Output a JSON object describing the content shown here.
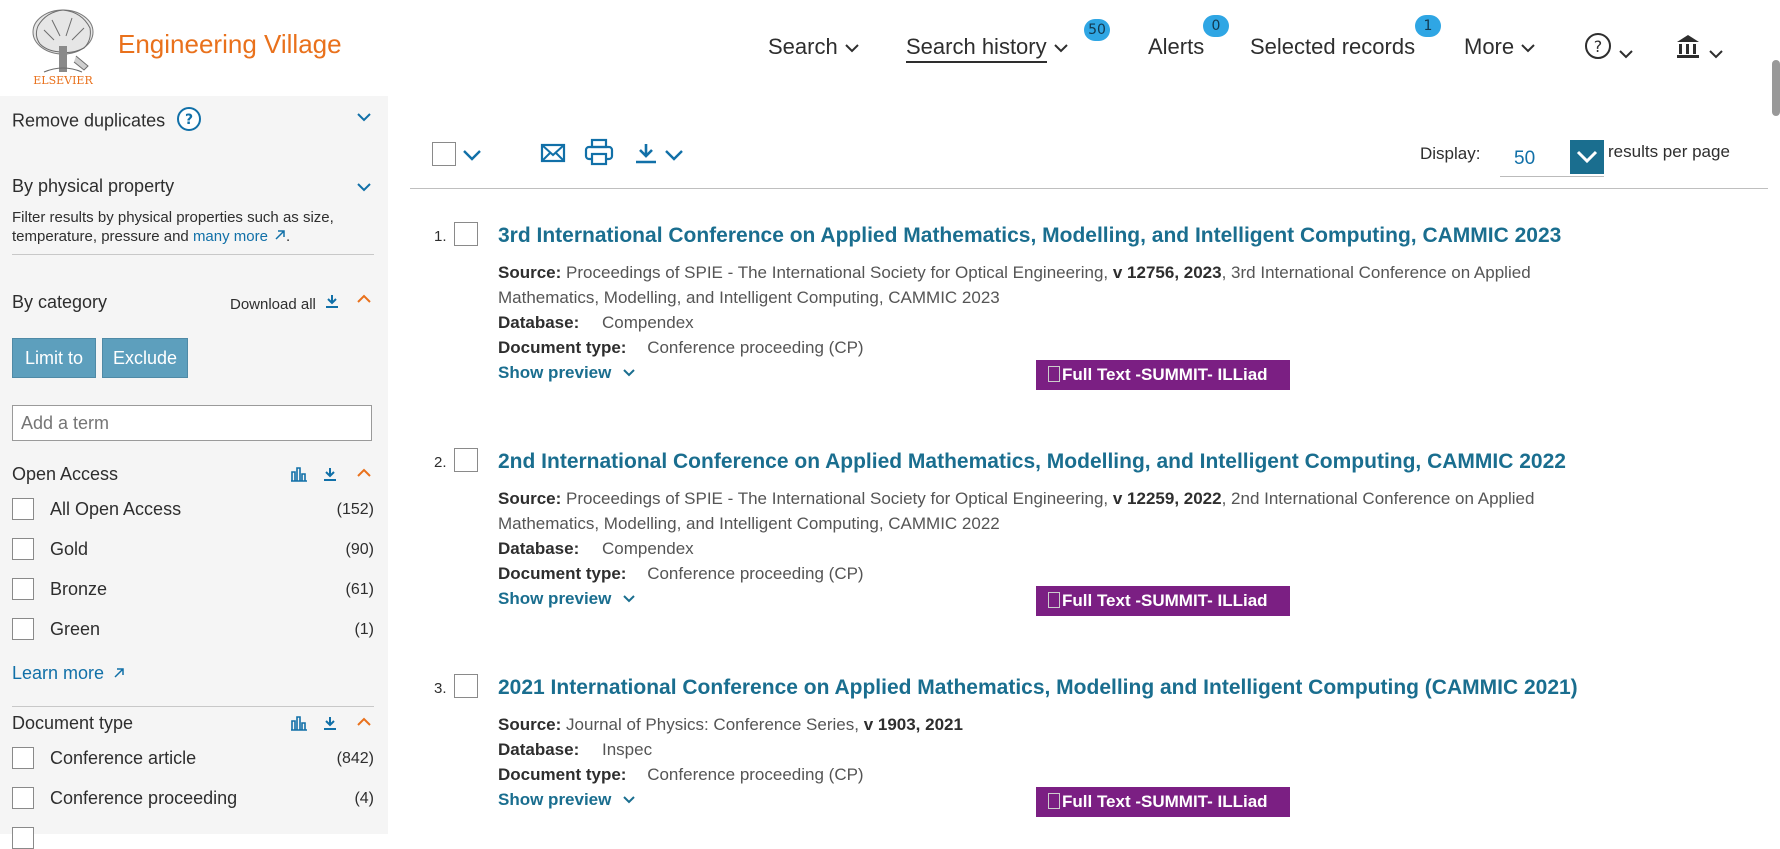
{
  "header": {
    "brand": "Engineering Village",
    "publisher": "ELSEVIER",
    "nav": [
      {
        "label": "Search",
        "has_chevron": true
      },
      {
        "label": "Search history",
        "has_chevron": true,
        "badge": "50"
      },
      {
        "label": "Alerts",
        "badge": "0"
      },
      {
        "label": "Selected records",
        "badge": "1"
      },
      {
        "label": "More",
        "has_chevron": true
      }
    ]
  },
  "sidebar": {
    "remove_duplicates": "Remove duplicates",
    "help_glyph": "?",
    "physical_property": {
      "title": "By physical property",
      "desc": "Filter results by physical properties such as size, temperature, pressure and ",
      "link": "many more",
      "desc_end": "."
    },
    "category": {
      "title": "By category",
      "download_all": "Download all",
      "limit_to": "Limit to",
      "exclude": "Exclude",
      "add_term_placeholder": "Add a term"
    },
    "open_access": {
      "title": "Open Access",
      "items": [
        {
          "label": "All Open Access",
          "count": "(152)"
        },
        {
          "label": "Gold",
          "count": "(90)"
        },
        {
          "label": "Bronze",
          "count": "(61)"
        },
        {
          "label": "Green",
          "count": "(1)"
        }
      ],
      "learn_more": "Learn more"
    },
    "document_type": {
      "title": "Document type",
      "items": [
        {
          "label": "Conference article",
          "count": "(842)"
        },
        {
          "label": "Conference proceeding",
          "count": "(4)"
        }
      ]
    }
  },
  "toolbar": {
    "display_label": "Display:",
    "display_value": "50",
    "per_page": "results per page"
  },
  "results": [
    {
      "num": "1.",
      "title": "3rd International Conference on Applied Mathematics, Modelling, and Intelligent Computing, CAMMIC 2023",
      "source_label": "Source:",
      "source_pub": "Proceedings of SPIE - The International Society for Optical Engineering",
      "source_vol": "v 12756, 2023",
      "source_conf": "3rd International Conference on Applied Mathematics, Modelling, and Intelligent Computing, CAMMIC 2023",
      "database_label": "Database:",
      "database": "Compendex",
      "doctype_label": "Document type:",
      "doctype": "Conference proceeding (CP)",
      "show_preview": "Show preview",
      "fulltext": "Full Text -SUMMIT- ILLiad"
    },
    {
      "num": "2.",
      "title": "2nd International Conference on Applied Mathematics, Modelling, and Intelligent Computing, CAMMIC 2022",
      "source_label": "Source:",
      "source_pub": "Proceedings of SPIE - The International Society for Optical Engineering",
      "source_vol": "v 12259, 2022",
      "source_conf": "2nd International Conference on Applied Mathematics, Modelling, and Intelligent Computing, CAMMIC 2022",
      "database_label": "Database:",
      "database": "Compendex",
      "doctype_label": "Document type:",
      "doctype": "Conference proceeding (CP)",
      "show_preview": "Show preview",
      "fulltext": "Full Text -SUMMIT- ILLiad"
    },
    {
      "num": "3.",
      "title": "2021 International Conference on Applied Mathematics, Modelling and Intelligent Computing (CAMMIC 2021)",
      "source_label": "Source:",
      "source_pub": "Journal of Physics: Conference Series",
      "source_vol": "v 1903, 2021",
      "source_conf": "",
      "database_label": "Database:",
      "database": "Inspec",
      "doctype_label": "Document type:",
      "doctype": "Conference proceeding (CP)",
      "show_preview": "Show preview",
      "fulltext": "Full Text -SUMMIT- ILLiad"
    }
  ],
  "colors": {
    "brand": "#e9711c",
    "link": "#1170a8",
    "title": "#1a6e8f",
    "badge": "#2fa6e4",
    "fulltext_bg": "#7b1f83",
    "button_bg": "#5d9fbd"
  }
}
